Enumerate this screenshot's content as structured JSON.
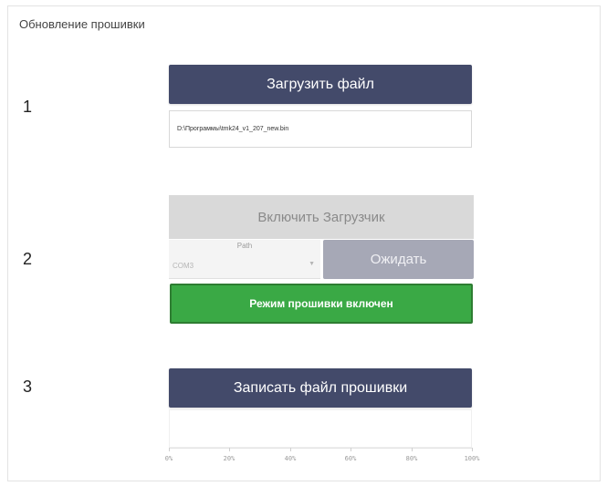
{
  "panel": {
    "title": "Обновление прошивки"
  },
  "step1": {
    "number": "1",
    "load_button": "Загрузить файл",
    "file_path": "D:\\Программы\\tmk24_v1_207_new.bin"
  },
  "step2": {
    "number": "2",
    "enable_bootloader_button": "Включить Загрузчик",
    "path_label": "Path",
    "path_value": "COM3",
    "wait_button": "Ожидать",
    "status_text": "Режим прошивки включен"
  },
  "step3": {
    "number": "3",
    "write_button": "Записать файл прошивки",
    "progress_percent": 0,
    "ticks": [
      "0%",
      "20%",
      "40%",
      "60%",
      "80%",
      "100%"
    ]
  },
  "colors": {
    "primary_button": "#434a6a",
    "status_success": "#3aa945",
    "disabled_button": "#d9d9d9",
    "wait_button": "#a6a8b6"
  }
}
